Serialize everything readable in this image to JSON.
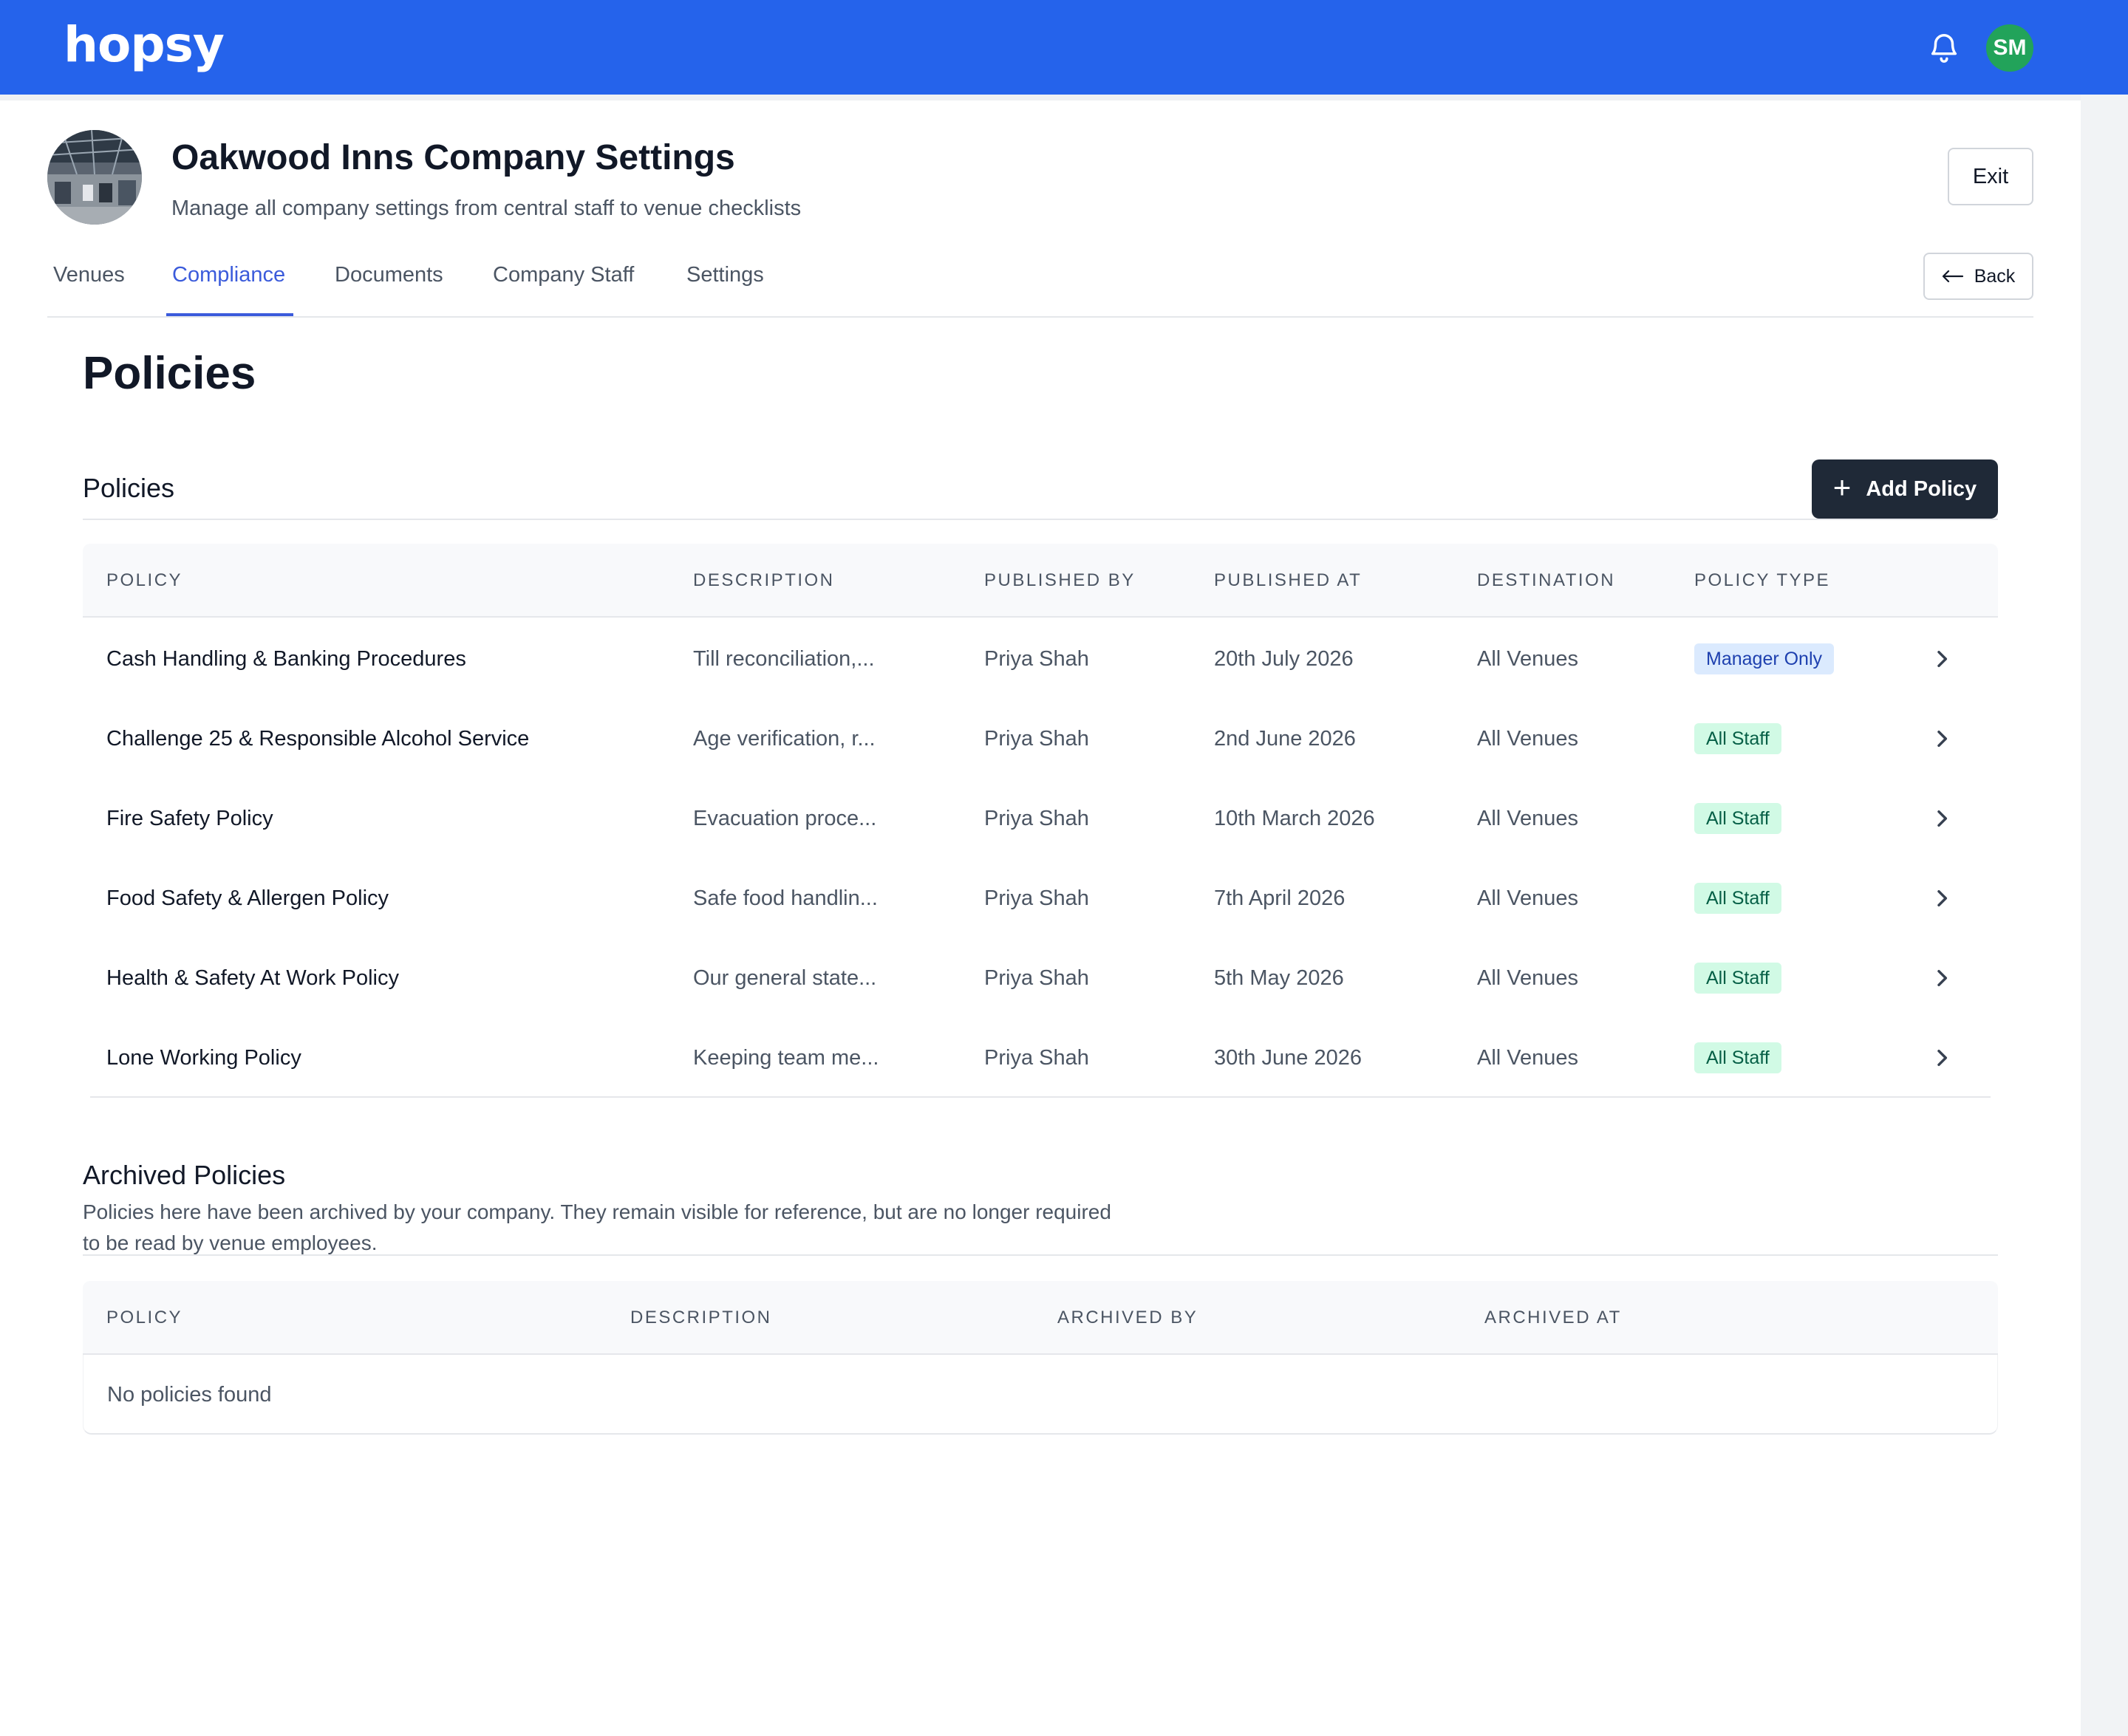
{
  "brand": {
    "logo": "hopsy",
    "accent": "#2563eb"
  },
  "user": {
    "initials": "SM"
  },
  "header": {
    "title": "Oakwood Inns Company Settings",
    "subtitle": "Manage all company settings from central staff to venue checklists",
    "exit_label": "Exit",
    "back_label": "Back"
  },
  "tabs": [
    {
      "label": "Venues"
    },
    {
      "label": "Compliance",
      "active": true
    },
    {
      "label": "Documents"
    },
    {
      "label": "Company Staff"
    },
    {
      "label": "Settings"
    }
  ],
  "page_title": "Policies",
  "policies": {
    "section_title": "Policies",
    "add_label": "Add Policy",
    "columns": [
      "POLICY",
      "DESCRIPTION",
      "PUBLISHED BY",
      "PUBLISHED AT",
      "DESTINATION",
      "POLICY TYPE"
    ],
    "rows": [
      {
        "policy": "Cash Handling & Banking Procedures",
        "description": "Till reconciliation,...",
        "published_by": "Priya Shah",
        "published_at": "20th July 2026",
        "destination": "All Venues",
        "type": "Manager Only",
        "type_kind": "manager"
      },
      {
        "policy": "Challenge 25 & Responsible Alcohol Service",
        "description": "Age verification, r...",
        "published_by": "Priya Shah",
        "published_at": "2nd June 2026",
        "destination": "All Venues",
        "type": "All Staff",
        "type_kind": "staff"
      },
      {
        "policy": "Fire Safety Policy",
        "description": "Evacuation proce...",
        "published_by": "Priya Shah",
        "published_at": "10th March 2026",
        "destination": "All Venues",
        "type": "All Staff",
        "type_kind": "staff"
      },
      {
        "policy": "Food Safety & Allergen Policy",
        "description": "Safe food handlin...",
        "published_by": "Priya Shah",
        "published_at": "7th April 2026",
        "destination": "All Venues",
        "type": "All Staff",
        "type_kind": "staff"
      },
      {
        "policy": "Health & Safety At Work Policy",
        "description": "Our general state...",
        "published_by": "Priya Shah",
        "published_at": "5th May 2026",
        "destination": "All Venues",
        "type": "All Staff",
        "type_kind": "staff"
      },
      {
        "policy": "Lone Working Policy",
        "description": "Keeping team me...",
        "published_by": "Priya Shah",
        "published_at": "30th June 2026",
        "destination": "All Venues",
        "type": "All Staff",
        "type_kind": "staff"
      }
    ]
  },
  "archived": {
    "title": "Archived Policies",
    "description": "Policies here have been archived by your company. They remain visible for reference, but are no longer required to be read by venue employees.",
    "columns": [
      "POLICY",
      "DESCRIPTION",
      "ARCHIVED BY",
      "ARCHIVED AT"
    ],
    "empty_text": "No policies found"
  },
  "icons": {
    "bell": "bell-icon",
    "back": "arrow-left-icon",
    "add": "plus-icon",
    "row": "chevron-right-icon"
  }
}
